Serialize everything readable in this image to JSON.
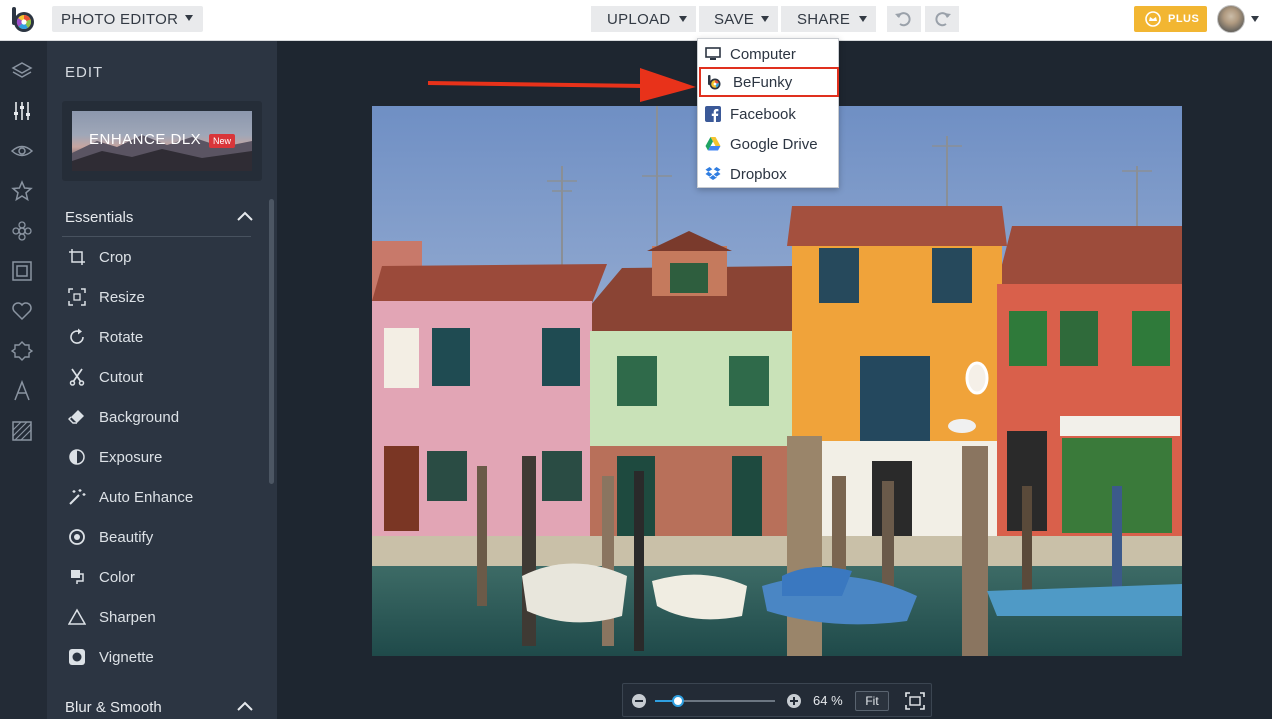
{
  "topbar": {
    "app_select": "PHOTO EDITOR",
    "upload": "UPLOAD",
    "save": "SAVE",
    "share": "SHARE",
    "plus": "PLUS"
  },
  "save_menu": {
    "items": [
      {
        "label": "Computer",
        "icon": "monitor-icon"
      },
      {
        "label": "BeFunky",
        "icon": "befunky-icon"
      },
      {
        "label": "Facebook",
        "icon": "facebook-icon"
      },
      {
        "label": "Google Drive",
        "icon": "google-drive-icon"
      },
      {
        "label": "Dropbox",
        "icon": "dropbox-icon"
      }
    ],
    "highlighted": "BeFunky"
  },
  "rail": {
    "icons": [
      "layers-icon",
      "sliders-icon",
      "eye-icon",
      "star-icon",
      "flower-icon",
      "frame-icon",
      "heart-icon",
      "badge-icon",
      "text-icon",
      "texture-icon"
    ],
    "active": "sliders-icon"
  },
  "panel": {
    "title": "EDIT",
    "enhance_label": "ENHANCE DLX",
    "enhance_badge": "New",
    "sections": [
      {
        "title": "Essentials",
        "tools": [
          {
            "label": "Crop",
            "icon": "crop-icon"
          },
          {
            "label": "Resize",
            "icon": "resize-icon"
          },
          {
            "label": "Rotate",
            "icon": "rotate-icon"
          },
          {
            "label": "Cutout",
            "icon": "scissors-icon"
          },
          {
            "label": "Background",
            "icon": "eraser-icon"
          },
          {
            "label": "Exposure",
            "icon": "exposure-icon"
          },
          {
            "label": "Auto Enhance",
            "icon": "magic-wand-icon"
          },
          {
            "label": "Beautify",
            "icon": "beautify-icon"
          },
          {
            "label": "Color",
            "icon": "paint-bucket-icon"
          },
          {
            "label": "Sharpen",
            "icon": "triangle-icon"
          },
          {
            "label": "Vignette",
            "icon": "vignette-icon"
          }
        ]
      },
      {
        "title": "Blur & Smooth",
        "tools": []
      }
    ]
  },
  "zoom": {
    "value": 0.64,
    "label": "64 %",
    "fit": "Fit"
  },
  "colors": {
    "accent": "#2f9fe0",
    "plus": "#f2b632",
    "highlight": "#e0301e",
    "arrow": "#e8321a"
  }
}
